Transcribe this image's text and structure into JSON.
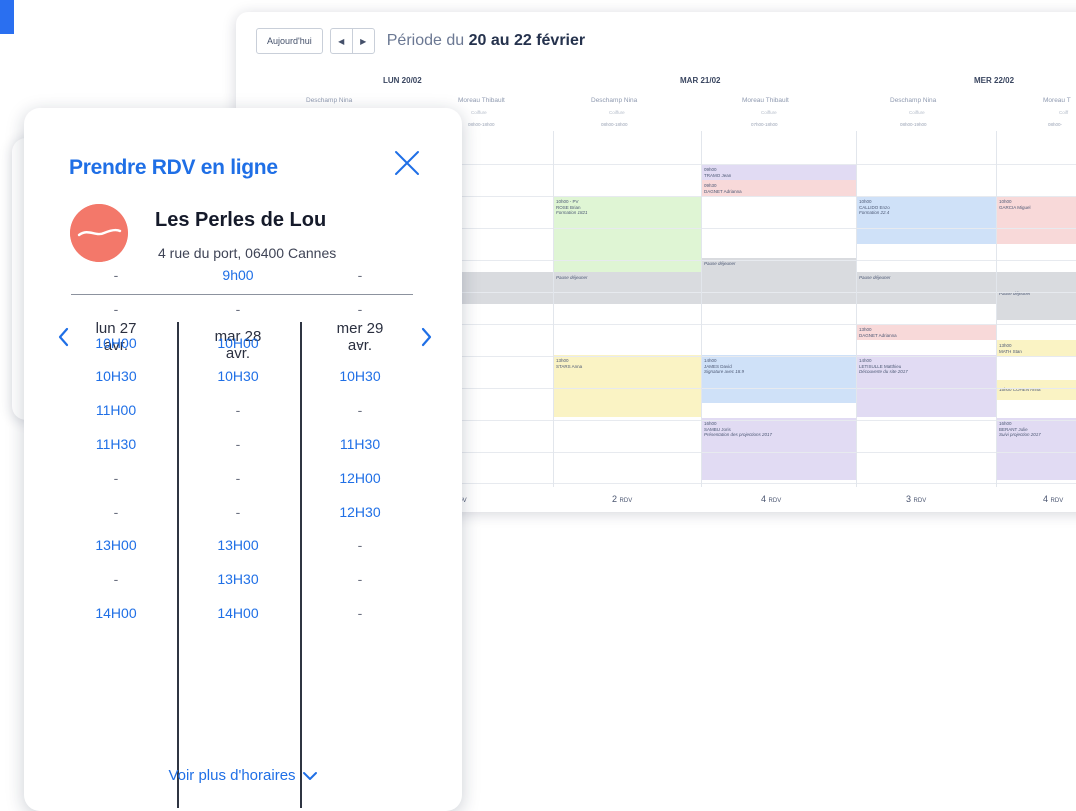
{
  "calendar": {
    "today_label": "Aujourd'hui",
    "period_prefix": "Période du",
    "period_range": "20 au 22 février",
    "days": [
      {
        "label": "LUN 20/02",
        "rdv_count": "4",
        "rdv_unit": "RDV"
      },
      {
        "label": "MAR 21/02",
        "rdv_count": "2",
        "rdv_unit": "RDV"
      },
      {
        "label": "MER 22/02",
        "rdv_count": "4",
        "rdv_unit": "RDV"
      }
    ],
    "practitioners": [
      {
        "name": "Deschamp Nina",
        "role": "Coiffure",
        "hours": ""
      },
      {
        "name": "Moreau Thibault",
        "role": "Coiffure",
        "hours": "08h00-18h00"
      },
      {
        "name": "Deschamp Nina",
        "role": "Coiffure",
        "hours": "08h00-18h00"
      },
      {
        "name": "Moreau Thibault",
        "role": "Coiffure",
        "hours": "07h00-18h00"
      },
      {
        "name": "Deschamp Nina",
        "role": "Coiffure",
        "hours": "08h00-19h00"
      },
      {
        "name": "Moreau T",
        "role": "Coiff",
        "hours": "08h00-"
      }
    ],
    "rdv_counts": [
      {
        "count": "",
        "unit": "RDV"
      },
      {
        "count": "2",
        "unit": "RDV"
      },
      {
        "count": "4",
        "unit": "RDV"
      },
      {
        "count": "3",
        "unit": "RDV"
      },
      {
        "count": "4",
        "unit": "RDV"
      }
    ],
    "events": [
      {
        "lines": [
          "09h00",
          "TRAMO Jean"
        ]
      },
      {
        "lines": [
          "09h30",
          "DAGNET Adrianna"
        ]
      },
      {
        "lines": [
          "10h00 - PV",
          "ROSE Brian",
          "Formation 1821"
        ]
      },
      {
        "lines": [
          "10h00",
          "CALLIDO Enzo",
          "Formation 22.4"
        ]
      },
      {
        "lines": [
          "10h00",
          "GARCIA Miguel"
        ]
      },
      {
        "lines": [
          "Pause déjeuner"
        ]
      },
      {
        "lines": [
          "Pause déjeuner"
        ]
      },
      {
        "lines": [
          "Pause déjeuner"
        ]
      },
      {
        "lines": [
          "Pause déjeuner"
        ]
      },
      {
        "lines": [
          "13h00",
          "DAGNET Adrianna"
        ]
      },
      {
        "lines": [
          "13h00",
          "MATH Stan"
        ]
      },
      {
        "lines": [
          "13h00",
          "STARS Anna"
        ]
      },
      {
        "lines": [
          "14h00",
          "JAMES David",
          "Signature avec 18.9"
        ]
      },
      {
        "lines": [
          "14h00",
          "LETISULLE Matthieu",
          "Découverte du site 2017"
        ]
      },
      {
        "lines": [
          "15h00 COHEN Anna"
        ]
      },
      {
        "lines": [
          "16h00",
          "SAMBU Joris",
          "Présentation des projections 2017"
        ]
      },
      {
        "lines": [
          "16h00",
          "BERANT Julie",
          "Suivi projection 2017"
        ]
      }
    ]
  },
  "widget": {
    "title": "Prendre RDV en ligne",
    "salon_name": "Les Perles de Lou",
    "salon_address": "4 rue du port, 06400 Cannes",
    "more_label": "Voir plus d'horaires",
    "days": [
      {
        "day": "lun 27",
        "month": "avr.",
        "slots": [
          "-",
          "-",
          "10H00",
          "10H30",
          "11H00",
          "11H30",
          "-",
          "-",
          "13H00",
          "-",
          "14H00"
        ]
      },
      {
        "day": "mar 28",
        "month": "avr.",
        "slots": [
          "9h00",
          "-",
          "10H00",
          "10H30",
          "-",
          "-",
          "-",
          "-",
          "13H00",
          "13H30",
          "14H00"
        ]
      },
      {
        "day": "mer 29",
        "month": "avr.",
        "slots": [
          "-",
          "-",
          "-",
          "10H30",
          "-",
          "11H30",
          "12H00",
          "12H30",
          "-",
          "-",
          "-"
        ]
      }
    ]
  },
  "colors": {
    "accent": "#1f6fe6",
    "avatar": "#f3786a",
    "event_cyan": "#c9f1f6",
    "event_green": "#dff5d4",
    "event_blue": "#cfe1f8",
    "event_pink": "#f8d9d9",
    "event_purple": "#e1dbf3",
    "event_yellow": "#faf3c4",
    "event_grey": "#d9dbdf"
  }
}
